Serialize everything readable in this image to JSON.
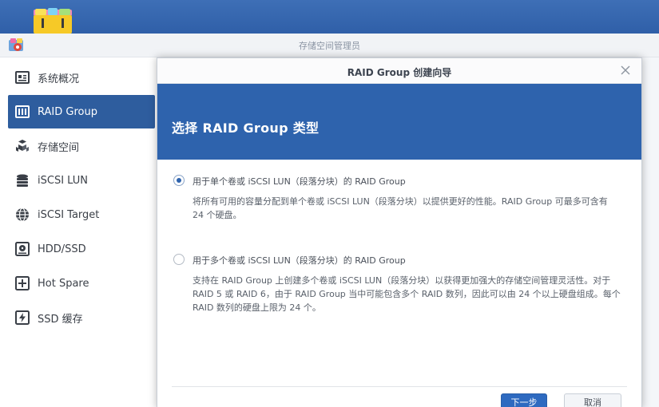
{
  "app": {
    "title": "存储空间管理员"
  },
  "sidebar": {
    "items": [
      {
        "label": "系统概况",
        "icon": "overview-icon",
        "active": false
      },
      {
        "label": "RAID Group",
        "icon": "raid-group-icon",
        "active": true
      },
      {
        "label": "存储空间",
        "icon": "volume-icon",
        "active": false
      },
      {
        "label": "iSCSI LUN",
        "icon": "iscsi-lun-icon",
        "active": false
      },
      {
        "label": "iSCSI Target",
        "icon": "iscsi-target-icon",
        "active": false
      },
      {
        "label": "HDD/SSD",
        "icon": "hdd-ssd-icon",
        "active": false
      },
      {
        "label": "Hot Spare",
        "icon": "hot-spare-icon",
        "active": false
      },
      {
        "label": "SSD 缓存",
        "icon": "ssd-cache-icon",
        "active": false
      }
    ]
  },
  "modal": {
    "title": "RAID Group 创建向导",
    "banner_title": "选择 RAID Group 类型",
    "options": [
      {
        "label": "用于单个卷或 iSCSI LUN（段落分块）的 RAID Group",
        "description": "将所有可用的容量分配到单个卷或 iSCSI LUN（段落分块）以提供更好的性能。RAID Group 可最多可含有 24 个硬盘。",
        "selected": true
      },
      {
        "label": "用于多个卷或 iSCSI LUN（段落分块）的 RAID Group",
        "description": "支持在 RAID Group 上创建多个卷或 iSCSI LUN（段落分块）以获得更加强大的存储空间管理灵活性。对于RAID 5 或 RAID 6，由于 RAID Group 当中可能包含多个 RAID 数列，因此可以由 24 个以上硬盘组成。每个 RAID 数列的硬盘上限为 24 个。",
        "selected": false
      }
    ],
    "buttons": {
      "next": "下一步",
      "cancel": "取消"
    }
  },
  "colors": {
    "desktop_bar": "#2f5fa8",
    "accent": "#2e63ad",
    "sidebar_active": "#2e5d9e"
  }
}
